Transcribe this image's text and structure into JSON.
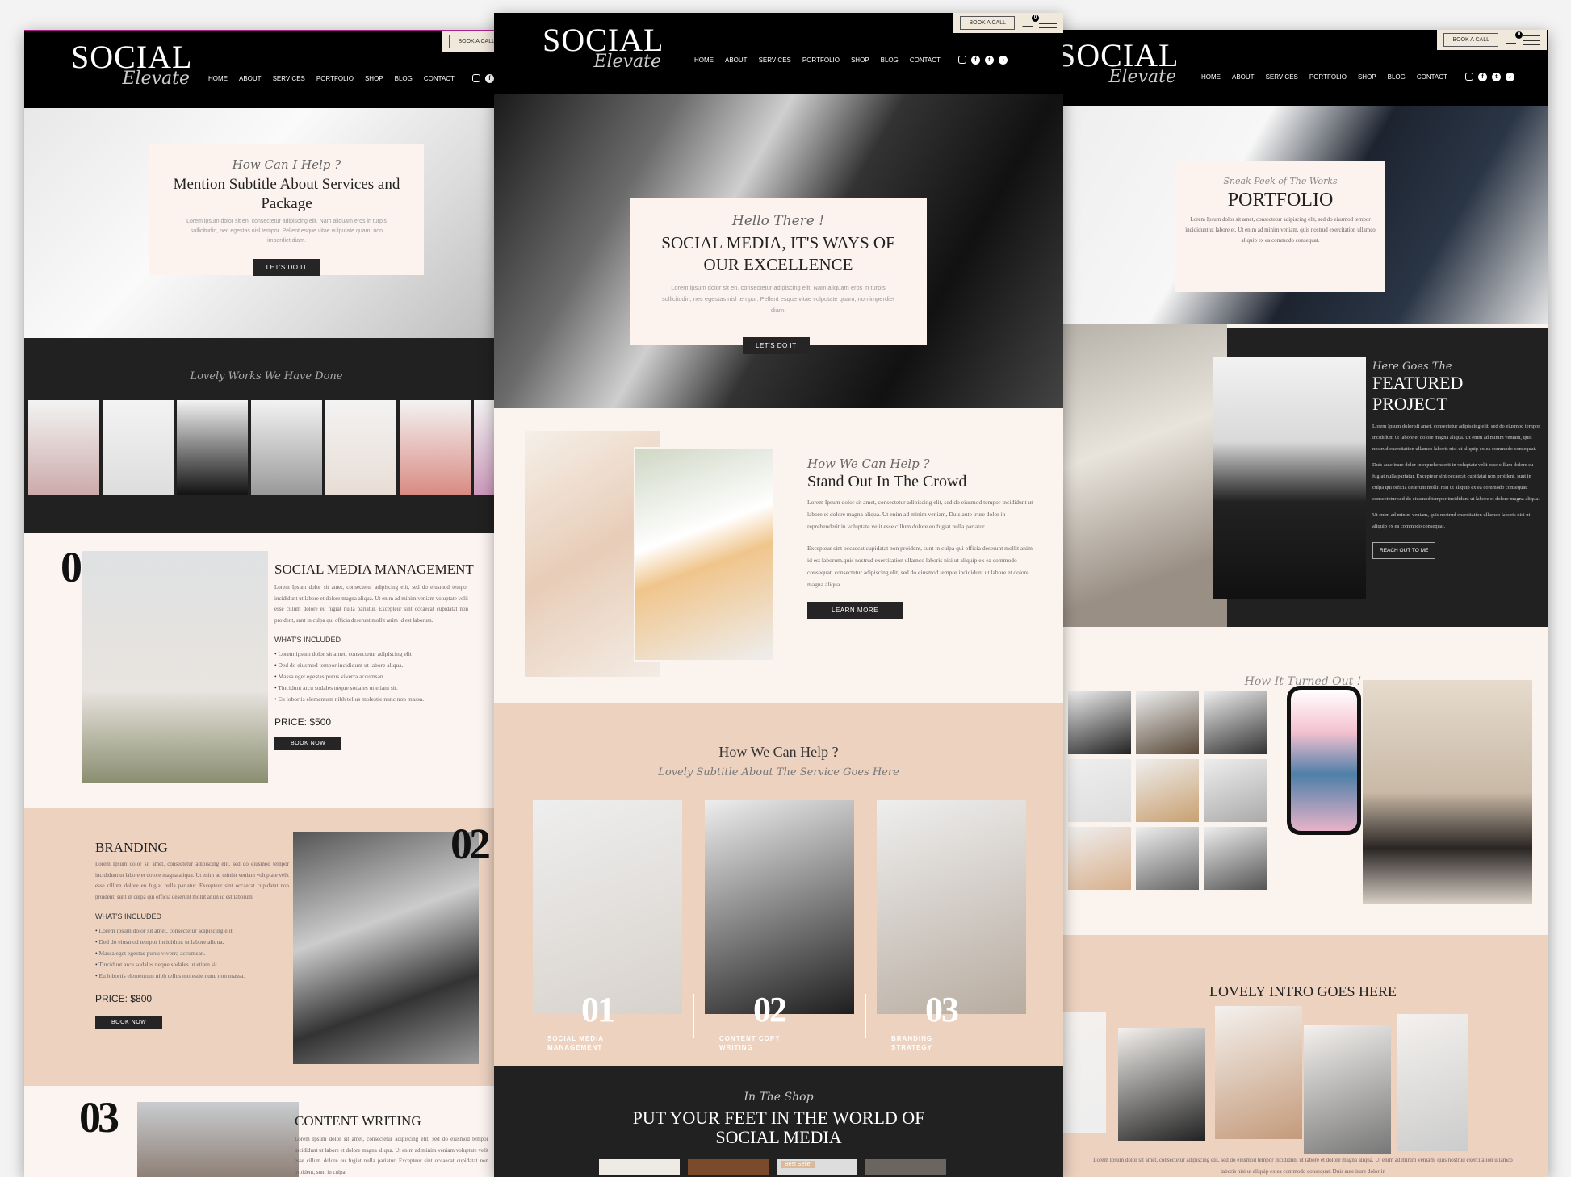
{
  "brand": {
    "line1": "SOCIAL",
    "line2": "Elevate"
  },
  "nav": [
    "HOME",
    "ABOUT",
    "SERVICES",
    "PORTFOLIO",
    "SHOP",
    "BLOG",
    "CONTACT"
  ],
  "social_icons": [
    "instagram-icon",
    "facebook-icon",
    "twitter-icon",
    "tiktok-icon"
  ],
  "topbar": {
    "book_call": "BOOK A CALL",
    "cart_count": "0"
  },
  "colors": {
    "header": "#000000",
    "cream": "#fcf4f0",
    "blush": "#edd2c0",
    "dark": "#222122",
    "button": "#262425"
  },
  "services_page": {
    "hero": {
      "script": "How Can I Help ?",
      "title": "Mention Subtitle About Services and Package",
      "body": "Lorem ipsum dolor sit en, consectetur adipiscing elit. Nam aliquam eros in turpis sollicitudin, nec egestas nisl tempor. Pellent esque vitae vulputate quam, non imperdiet diam.",
      "cta": "LET'S DO IT"
    },
    "works_script": "Lovely Works We Have Done",
    "services": [
      {
        "num": "01",
        "title": "SOCIAL MEDIA MANAGEMENT",
        "body": "Lorem Ipsum dolor sit amet, consectetur adipiscing elit, sed do eiusmod tempor incididunt ut labore et dolore magna aliqua. Ut enim ad minim veniam voluptate velit esse cillum dolore eu fugiat nulla pariatur. Excepteur sint occaecat cupidatat non proident, sunt in culpa qui officia deserunt mollit anim id est laborum.",
        "included_label": "WHAT'S INCLUDED",
        "included": [
          "Lorem ipsum dolor sit amet, consectetur adipiscing elit",
          "Ded do eiusmod tempor incididunt ut labore aliqua.",
          "Massa eget egestas purus viverra accumsan.",
          "Tincidunt arcu sodales neque sodales ut etiam sit.",
          "Eu lobortis elementum nibh tellus molestie nunc non massa."
        ],
        "price": "PRICE:  $500",
        "cta": "BOOK NOW"
      },
      {
        "num": "02",
        "title": "BRANDING",
        "body": "Lorem Ipsum dolor sit amet, consectetur adipiscing elit, sed do eiusmod tempor incididunt ut labore et dolore magna aliqua. Ut enim ad minim veniam voluptate velit esse cillum dolore eu fugiat nulla pariatur. Excepteur sint occaecat cupidatat non proident, sunt in culpa qui officia deserunt mollit anim id est laborum.",
        "included_label": "WHAT'S INCLUDED",
        "included": [
          "Lorem ipsum dolor sit amet, consectetur adipiscing elit",
          "Ded do eiusmod tempor incididunt ut labore aliqua.",
          "Massa eget egestas purus viverra accumsan.",
          "Tincidunt arcu sodales neque sodales ut etiam sit.",
          "Eu lobortis elementum nibh tellus molestie nunc non massa."
        ],
        "price": "PRICE:  $800",
        "cta": "BOOK NOW"
      },
      {
        "num": "03",
        "title": "CONTENT WRITING",
        "body": "Lorem Ipsum dolor sit amet, consectetur adipiscing elit, sed do eiusmod tempor incididunt ut labore et dolore magna aliqua. Ut enim ad minim veniam voluptate velit esse cillum dolore eu fugiat nulla pariatur. Excepteur sint occaecat cupidatat non proident, sunt in culpa"
      }
    ]
  },
  "home_page": {
    "hero": {
      "script": "Hello There !",
      "title": "SOCIAL MEDIA, IT'S WAYS OF OUR EXCELLENCE",
      "body": "Lorem ipsum dolor sit en, consectetur adipiscing elit. Nam aliquam eros in turpis sollicitudin, nec egestas nisl tempor. Pellent esque vitae vulputate quam, non imperdiet diam.",
      "cta": "LET'S DO IT"
    },
    "about": {
      "script": "How We Can Help ?",
      "title": "Stand Out In The Crowd",
      "p1": "Lorem Ipsum dolor sit amet, consectetur adipiscing elit, sed do eiusmod tempor incididunt ut labore et dolore magna aliqua. Ut enim ad minim veniam, Duis aute irure dolor in reprehenderit in voluptate velit esse cillum dolore eu fugiat nulla pariatur.",
      "p2": "Excepteur sint occaecat cupidatat non proident, sunt in culpa qui officia deserunt mollit anim id est laborum.quis nostrud exercitation ullamco laboris nisi ut aliquip ex ea commodo consequat. consectetur adipiscing elit, sed do eiusmod tempor incididunt ut labore et dolore magna aliqua.",
      "cta": "LEARN MORE"
    },
    "help": {
      "title": "How We Can Help ?",
      "script": "Lovely Subtitle About The Service Goes Here",
      "items": [
        {
          "num": "01",
          "label": "SOCIAL MEDIA MANAGEMENT"
        },
        {
          "num": "02",
          "label": "CONTENT COPY WRITING"
        },
        {
          "num": "03",
          "label": "BRANDING STRATEGY"
        }
      ]
    },
    "shop": {
      "script": "In The Shop",
      "title": "PUT YOUR FEET IN THE WORLD OF SOCIAL MEDIA",
      "badge": "Best Seller"
    }
  },
  "portfolio_page": {
    "hero": {
      "script": "Sneak Peek of The Works",
      "title": "PORTFOLIO",
      "body": "Lorem Ipsum dolor sit amet, consectetur adipiscing elit, sed do eiusmod tempor incididunt ut labore et. Ut enim ad minim veniam, quis nostrud exercitation ullamco aliquip ex ea commodo consequat."
    },
    "featured": {
      "script": "Here Goes The",
      "title": "FEATURED PROJECT",
      "p1": "Lorem Ipsum dolor sit amet, consectetur adipiscing elit, sed do eiusmod tempor incididunt ut labore et dolore magna aliqua. Ut enim ad minim veniam, quis nostrud exercitation ullamco laboris nisi ut aliquip ex ea commodo consequat.",
      "p2": "Duis aute irure dolor in reprehenderit in voluptate velit esse cillum dolore eu fugiat nulla pariatur. Excepteur sint occaecat cupidatat non proident, sunt in culpa qui officia deserunt mollit nisi ut aliquip ex ea commodo consequat. consectetur sed do eiusmod tempor incididunt ut labore et dolore magna aliqua.",
      "p3": "Ut enim ad minim veniam, quis nostrud exercitation ullamco laboris nisi ut aliquip ex ea commodo consequat.",
      "cta": "REACH OUT TO ME"
    },
    "results_script": "How It Turned Out !",
    "intro": {
      "title": "LOVELY INTRO GOES HERE",
      "body": "Lorem Ipsum dolor sit amet, consectetur adipiscing elit, sed do eiusmod tempor incididunt ut labore et dolore magna aliqua. Ut enim ad minim veniam, quis nostrud exercitation ullamco laboris nisi ut aliquip ex ea commodo consequat. Duis aute irure dolor in"
    }
  }
}
